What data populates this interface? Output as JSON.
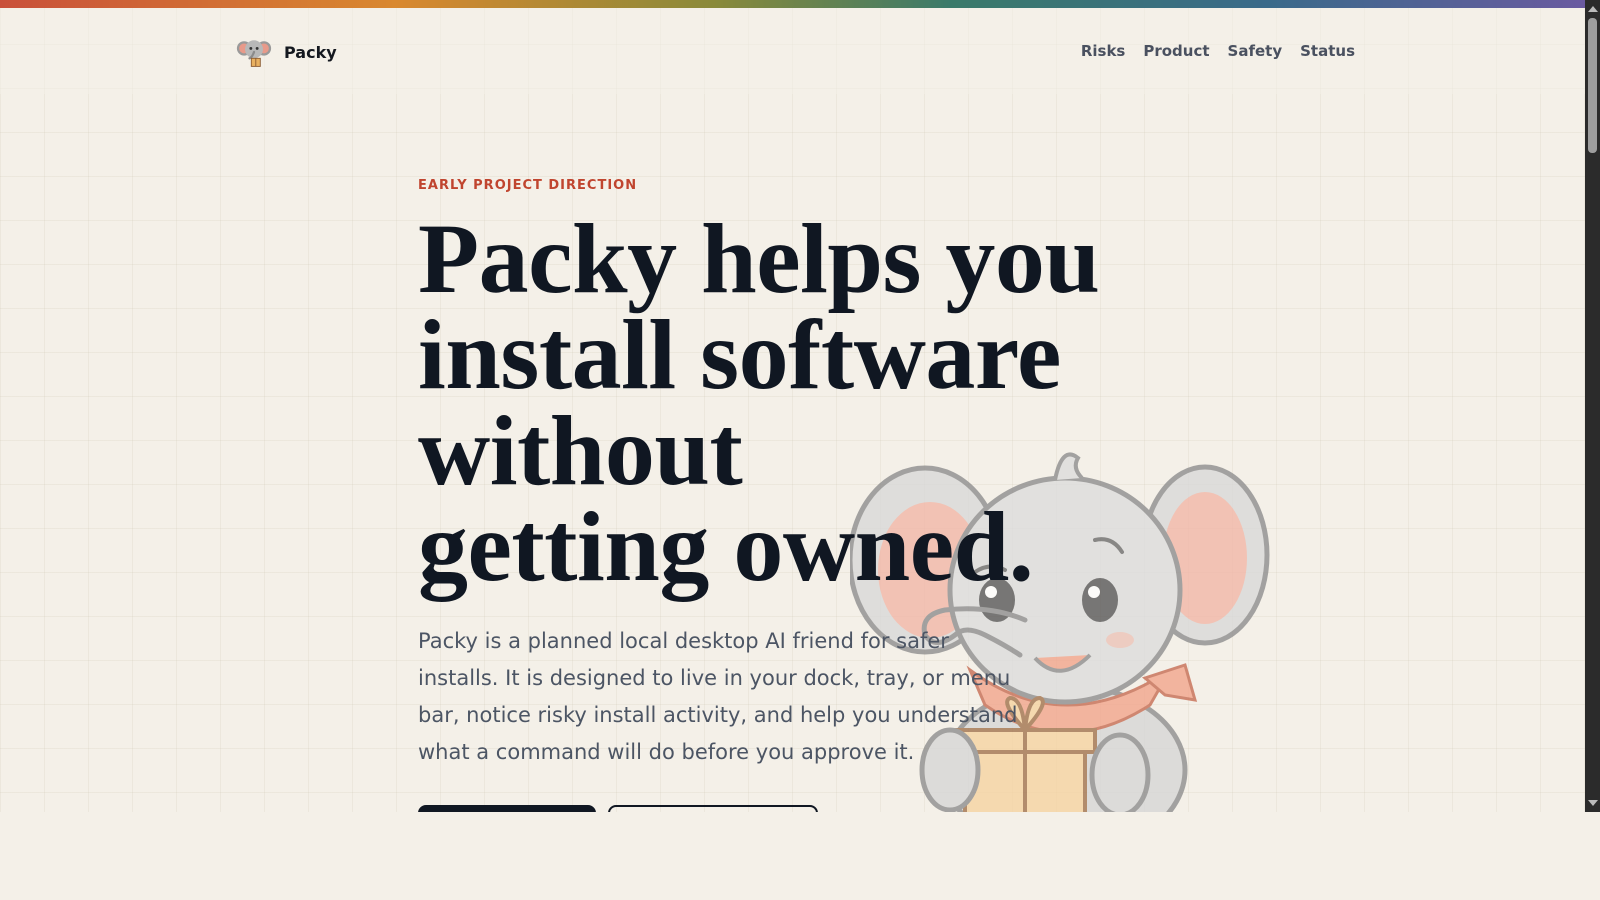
{
  "brand": {
    "name": "Packy",
    "logo_icon": "elephant-logo-icon"
  },
  "nav": {
    "items": [
      "Risks",
      "Product",
      "Safety",
      "Status"
    ]
  },
  "hero": {
    "eyebrow": "EARLY PROJECT DIRECTION",
    "headline_lines": [
      "Packy helps you",
      "install software",
      "without",
      "getting owned."
    ],
    "lede": "Packy is a planned local desktop AI friend for safer installs. It is designed to live in your dock, tray, or menu bar, notice risky install activity, and help you understand what a command will do before you approve it."
  },
  "colors": {
    "accent": "#c0452f",
    "ink": "#101722",
    "background": "#f4f0e8",
    "muted": "#4c5564"
  }
}
